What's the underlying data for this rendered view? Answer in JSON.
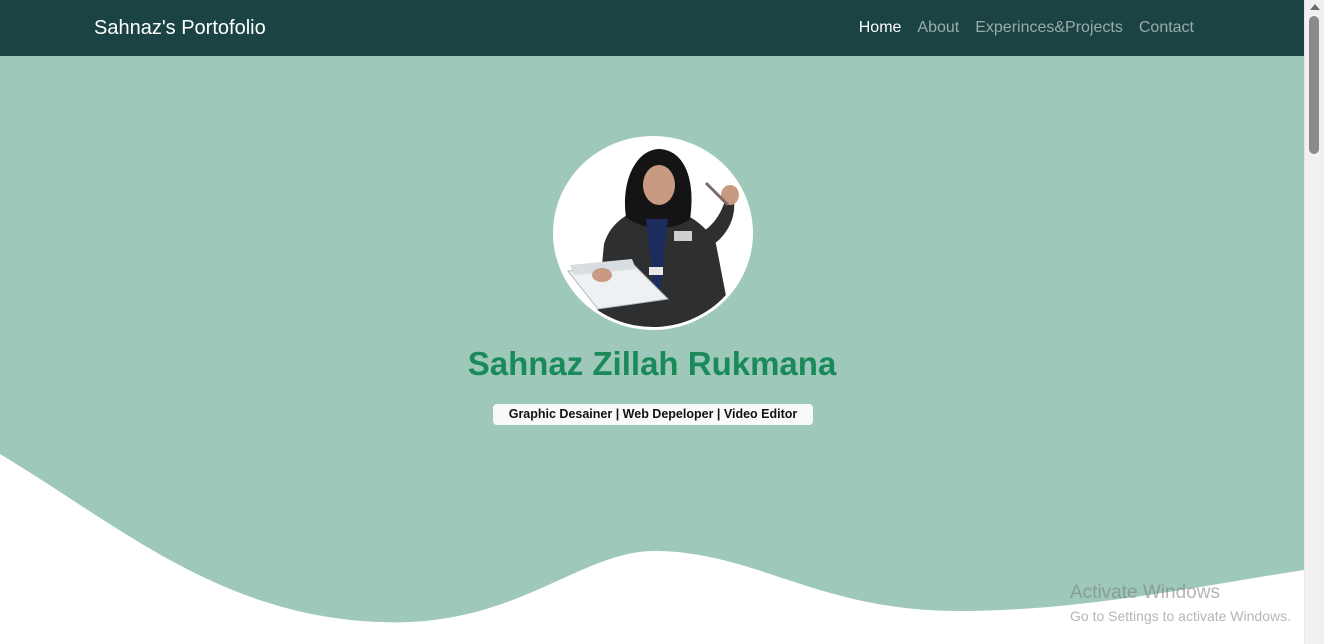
{
  "nav": {
    "brand": "Sahnaz's Portofolio",
    "links": [
      {
        "label": "Home",
        "active": true
      },
      {
        "label": "About",
        "active": false
      },
      {
        "label": "Experinces&Projects",
        "active": false
      },
      {
        "label": "Contact",
        "active": false
      }
    ]
  },
  "hero": {
    "name": "Sahnaz Zillah Rukmana",
    "roles": "Graphic Desainer | Web Depeloper | Video Editor"
  },
  "watermark": {
    "title": "Activate Windows",
    "subtitle": "Go to Settings to activate Windows."
  },
  "colors": {
    "navbar": "#1b4343",
    "hero_bg": "#9ec8b9",
    "name_text": "#1b8a5a"
  }
}
